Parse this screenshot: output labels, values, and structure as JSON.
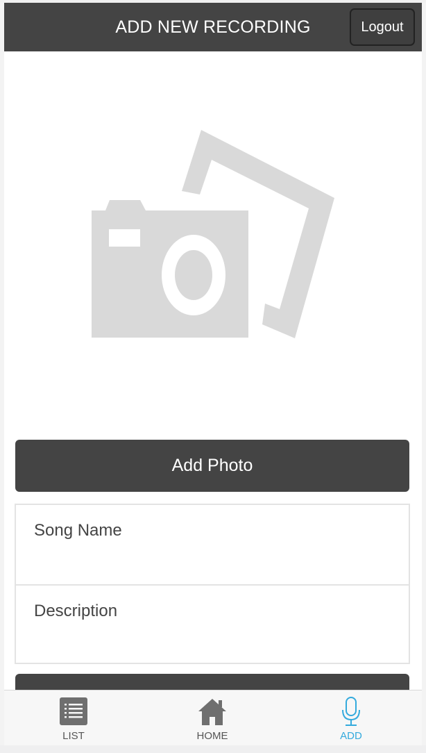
{
  "header": {
    "title": "ADD NEW RECORDING",
    "logout_label": "Logout"
  },
  "photo": {
    "placeholder_icon": "photo-camera-placeholder-icon",
    "add_photo_label": "Add Photo"
  },
  "form": {
    "song_name": {
      "placeholder": "Song Name",
      "value": ""
    },
    "description": {
      "placeholder": "Description",
      "value": ""
    }
  },
  "tabbar": {
    "tabs": [
      {
        "label": "LIST",
        "icon": "list-icon",
        "active": false
      },
      {
        "label": "HOME",
        "icon": "home-icon",
        "active": false
      },
      {
        "label": "ADD",
        "icon": "microphone-icon",
        "active": true
      }
    ]
  },
  "colors": {
    "header_bg": "#444444",
    "button_bg": "#444444",
    "placeholder_gray": "#d8d8d8",
    "active_tab": "#33aadd"
  }
}
